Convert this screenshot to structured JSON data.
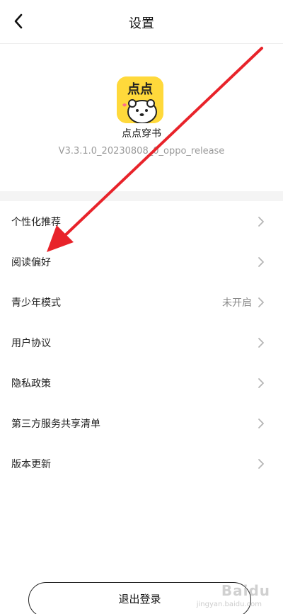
{
  "header": {
    "title": "设置"
  },
  "app": {
    "logo_text": "点点",
    "name": "点点穿书",
    "version": "V3.3.1.0_20230808_0_oppo_release"
  },
  "settings": [
    {
      "label": "个性化推荐",
      "value": ""
    },
    {
      "label": "阅读偏好",
      "value": ""
    },
    {
      "label": "青少年模式",
      "value": "未开启"
    },
    {
      "label": "用户协议",
      "value": ""
    },
    {
      "label": "隐私政策",
      "value": ""
    },
    {
      "label": "第三方服务共享清单",
      "value": ""
    },
    {
      "label": "版本更新",
      "value": ""
    }
  ],
  "logout": {
    "label": "退出登录"
  },
  "watermark": {
    "text": "Baidu",
    "sub": "jingyan.baidu.com"
  },
  "colors": {
    "annotation_arrow": "#e8232a",
    "logo_bg": "#ffd93b"
  },
  "icons": [
    "back-icon",
    "chevron-right-icon",
    "app-logo"
  ]
}
